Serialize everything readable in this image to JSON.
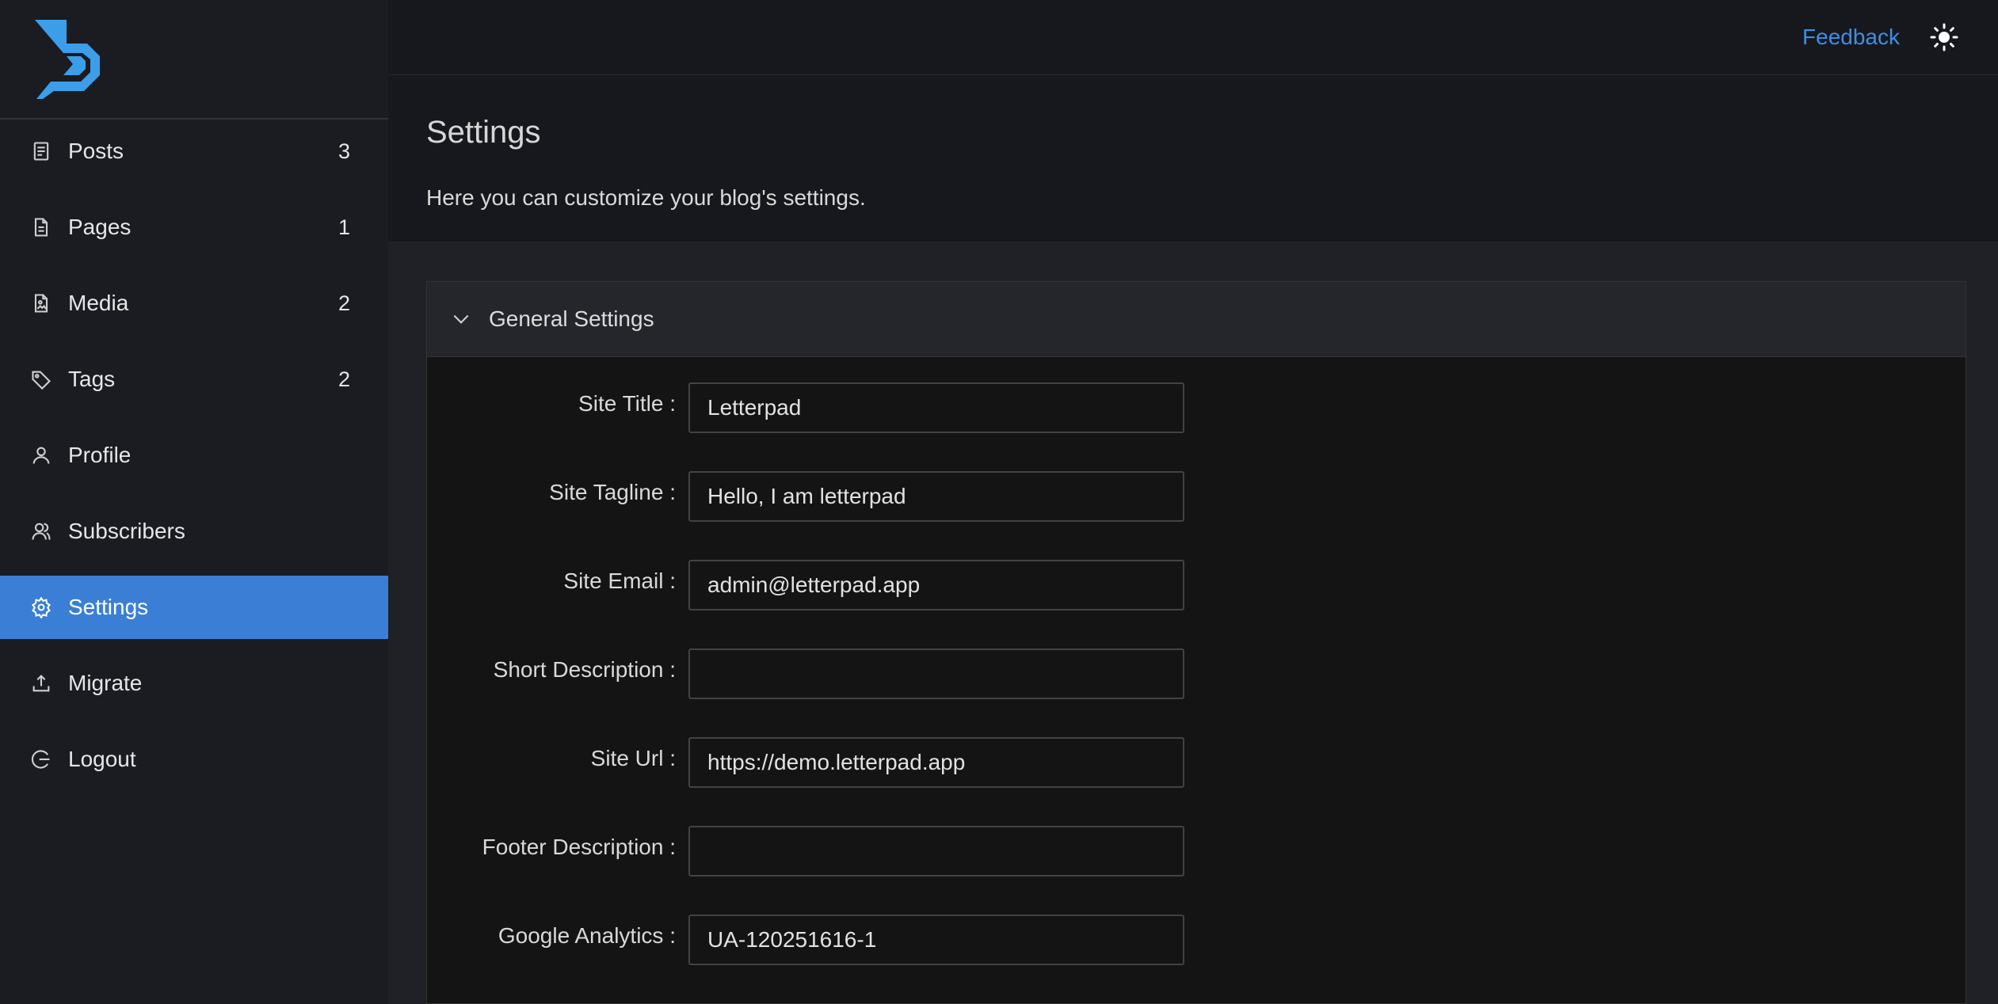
{
  "sidebar": {
    "items": [
      {
        "name": "posts",
        "label": "Posts",
        "count": "3",
        "icon": "document-list-icon"
      },
      {
        "name": "pages",
        "label": "Pages",
        "count": "1",
        "icon": "file-icon"
      },
      {
        "name": "media",
        "label": "Media",
        "count": "2",
        "icon": "image-file-icon"
      },
      {
        "name": "tags",
        "label": "Tags",
        "count": "2",
        "icon": "tag-icon"
      },
      {
        "name": "profile",
        "label": "Profile",
        "count": "",
        "icon": "user-icon"
      },
      {
        "name": "subscribers",
        "label": "Subscribers",
        "count": "",
        "icon": "users-icon"
      },
      {
        "name": "settings",
        "label": "Settings",
        "count": "",
        "icon": "gear-icon"
      },
      {
        "name": "migrate",
        "label": "Migrate",
        "count": "",
        "icon": "upload-icon"
      },
      {
        "name": "logout",
        "label": "Logout",
        "count": "",
        "icon": "logout-icon"
      }
    ],
    "active": "settings"
  },
  "topbar": {
    "feedback_label": "Feedback",
    "theme_icon": "sun-icon"
  },
  "page": {
    "title": "Settings",
    "description": "Here you can customize your blog's settings."
  },
  "general": {
    "title": "General Settings",
    "fields": [
      {
        "label": "Site Title",
        "value": "Letterpad"
      },
      {
        "label": "Site Tagline",
        "value": "Hello, I am letterpad"
      },
      {
        "label": "Site Email",
        "value": "admin@letterpad.app"
      },
      {
        "label": "Short Description",
        "value": ""
      },
      {
        "label": "Site Url",
        "value": "https://demo.letterpad.app"
      },
      {
        "label": "Footer Description",
        "value": ""
      },
      {
        "label": "Google Analytics",
        "value": "UA-120251616-1"
      }
    ]
  },
  "colors": {
    "accent": "#3a7fd5",
    "link": "#3e8ee6",
    "sidebar_bg": "#1a1c22",
    "content_bg": "#202127"
  }
}
